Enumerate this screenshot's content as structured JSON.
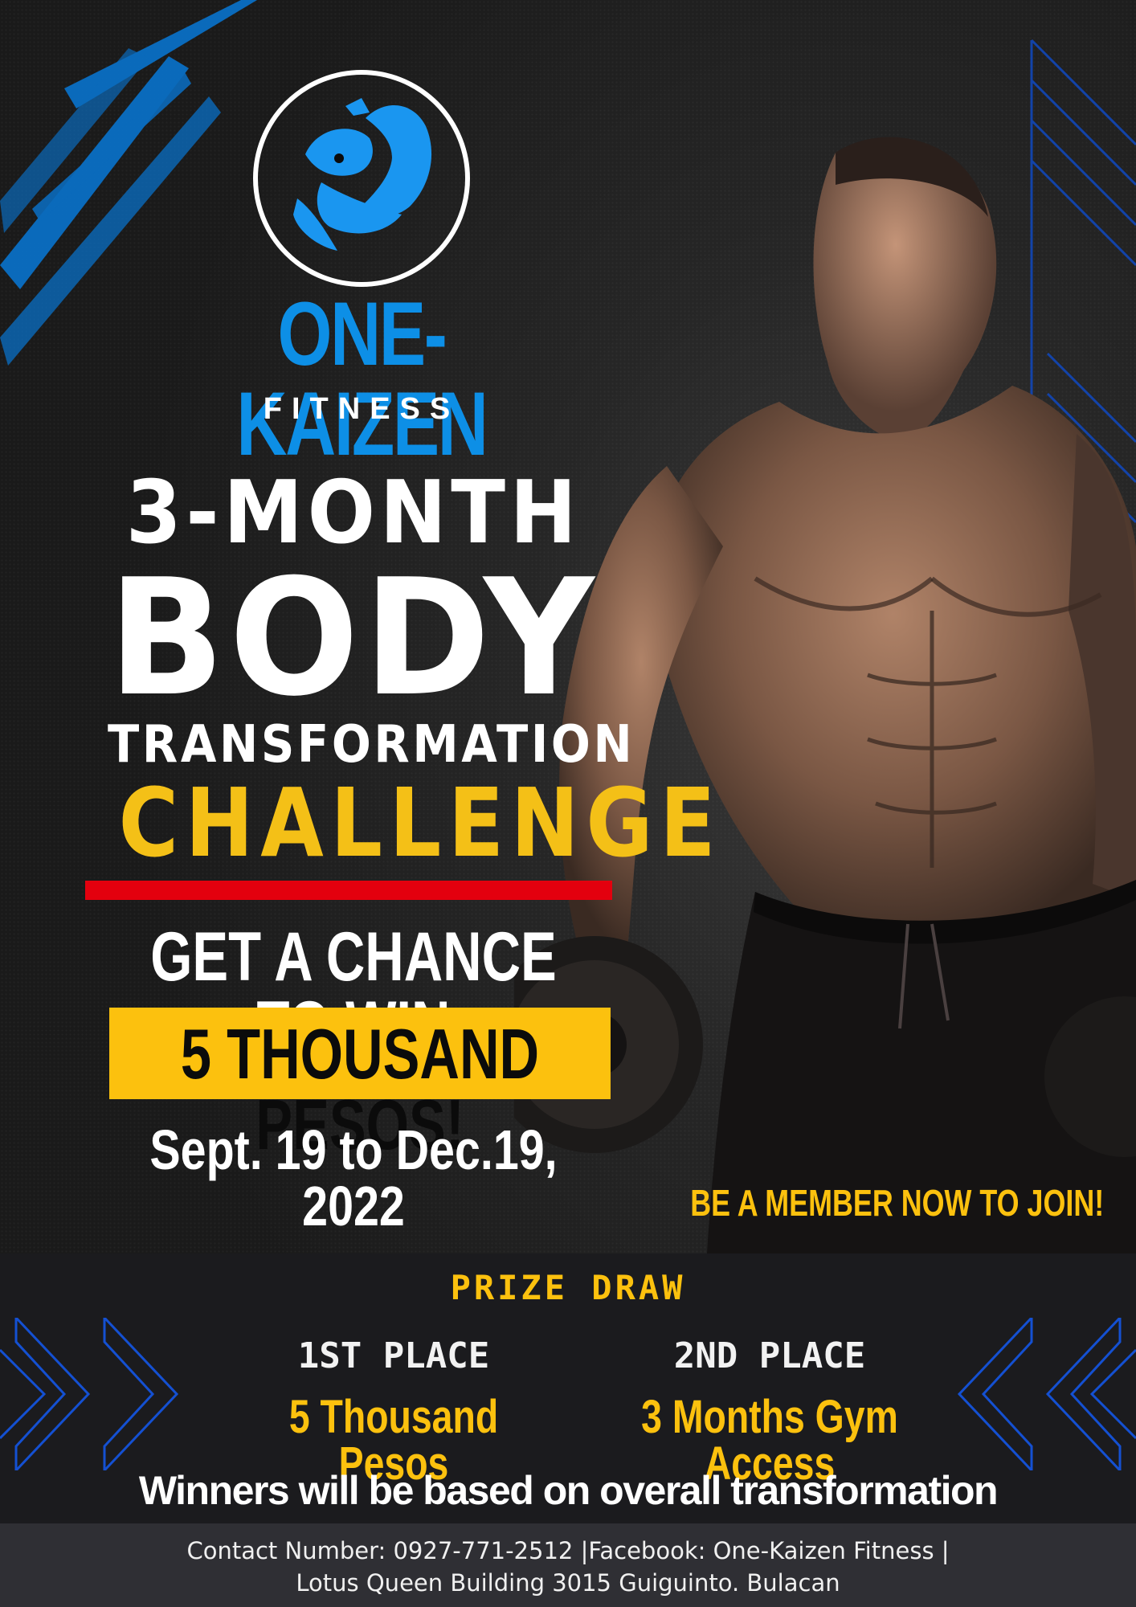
{
  "brand": {
    "name": "ONE-KAIZEN",
    "subtitle": "FITNESS"
  },
  "headline": {
    "line1": "3-MONTH",
    "line2": "BODY",
    "line3": "TRANSFORMATION",
    "line4": "CHALLENGE"
  },
  "offer": {
    "intro": "GET A CHANCE TO WIN",
    "prize": "5 THOUSAND PESOS!",
    "dates": "Sept. 19 to Dec.19, 2022",
    "cta": "BE A MEMBER NOW TO JOIN!"
  },
  "prize_draw": {
    "title": "PRIZE DRAW",
    "places": [
      {
        "label": "1ST PLACE",
        "prize": "5 Thousand Pesos"
      },
      {
        "label": "2ND PLACE",
        "prize": "3 Months Gym Access"
      }
    ],
    "note": "Winners will be based on overall transformation"
  },
  "footer": {
    "line1": "Contact Number: 0927-771-2512 |Facebook: One-Kaizen Fitness |",
    "line2": "Lotus Queen Building 3015 Guiguinto. Bulacan"
  },
  "colors": {
    "brand_blue": "#0d8fe6",
    "accent_yellow": "#fcc10e",
    "rule_red": "#e3000e",
    "background": "#1b1b1e"
  },
  "icons": {
    "logo": "flexing-arm-emblem-icon",
    "chevrons_left": "chevron-right-icon",
    "chevrons_right": "chevron-left-icon"
  }
}
